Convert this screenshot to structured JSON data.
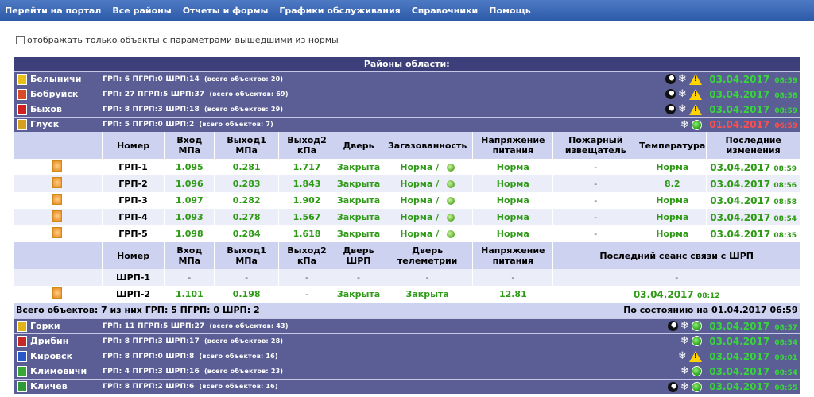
{
  "nav": [
    "Перейти на портал",
    "Все районы",
    "Отчеты и формы",
    "Графики обслуживания",
    "Справочники",
    "Помощь"
  ],
  "filter_label": "отображать только объекты с параметрами вышедшими из нормы",
  "table_title": "Районы области:",
  "regions_top": [
    {
      "name": "Белыничи",
      "grp": "ГРП: 6",
      "pgrp": "ПГРП:0",
      "shrp": "ШРП:14",
      "total": "(всего объектов: 20)",
      "date": "03.04.2017",
      "time": "08:59",
      "status": "ok",
      "icons": [
        "moon-icon",
        "snowflake-icon",
        "warning-icon"
      ],
      "coat": "#e8c01a"
    },
    {
      "name": "Бобруйск",
      "grp": "ГРП: 27",
      "pgrp": "ПГРП:5",
      "shrp": "ШРП:37",
      "total": "(всего объектов: 69)",
      "date": "03.04.2017",
      "time": "08:58",
      "status": "ok",
      "icons": [
        "moon-icon",
        "snowflake-icon",
        "warning-icon"
      ],
      "coat": "#d84a2a"
    },
    {
      "name": "Быхов",
      "grp": "ГРП: 8",
      "pgrp": "ПГРП:3",
      "shrp": "ШРП:18",
      "total": "(всего объектов: 29)",
      "date": "03.04.2017",
      "time": "08:59",
      "status": "ok",
      "icons": [
        "moon-icon",
        "snowflake-icon",
        "warning-icon"
      ],
      "coat": "#cc2222"
    },
    {
      "name": "Глуск",
      "grp": "ГРП: 5",
      "pgrp": "ПГРП:0",
      "shrp": "ШРП:2",
      "total": "(всего объектов: 7)",
      "date": "01.04.2017",
      "time": "06:59",
      "status": "bad",
      "icons": [
        "snowflake-icon",
        "ok-icon"
      ],
      "coat": "#d8a020"
    }
  ],
  "grp_headers": [
    "Номер",
    "Вход МПа",
    "Выход1 МПа",
    "Выход2 кПа",
    "Дверь",
    "Загазованность",
    "Напряжение питания",
    "Пожарный извещатель",
    "Температура",
    "Последние изменения"
  ],
  "grp_rows": [
    {
      "num": "ГРП-1",
      "in": "1.095",
      "out1": "0.281",
      "out2": "1.717",
      "door": "Закрыта",
      "gas": "Норма",
      "volt": "Норма",
      "fire": "-",
      "temp": "Норма",
      "date": "03.04.2017",
      "time": "08:59"
    },
    {
      "num": "ГРП-2",
      "in": "1.096",
      "out1": "0.283",
      "out2": "1.843",
      "door": "Закрыта",
      "gas": "Норма",
      "volt": "Норма",
      "fire": "-",
      "temp": "8.2",
      "date": "03.04.2017",
      "time": "08:56"
    },
    {
      "num": "ГРП-3",
      "in": "1.097",
      "out1": "0.282",
      "out2": "1.902",
      "door": "Закрыта",
      "gas": "Норма",
      "volt": "Норма",
      "fire": "-",
      "temp": "Норма",
      "date": "03.04.2017",
      "time": "08:58"
    },
    {
      "num": "ГРП-4",
      "in": "1.093",
      "out1": "0.278",
      "out2": "1.567",
      "door": "Закрыта",
      "gas": "Норма",
      "volt": "Норма",
      "fire": "-",
      "temp": "Норма",
      "date": "03.04.2017",
      "time": "08:54"
    },
    {
      "num": "ГРП-5",
      "in": "1.098",
      "out1": "0.284",
      "out2": "1.618",
      "door": "Закрыта",
      "gas": "Норма",
      "volt": "Норма",
      "fire": "-",
      "temp": "Норма",
      "date": "03.04.2017",
      "time": "08:35"
    }
  ],
  "shrp_headers": [
    "Номер",
    "Вход МПа",
    "Выход1 МПа",
    "Выход2 кПа",
    "Дверь ШРП",
    "Дверь телеметрии",
    "Напряжение питания",
    "Последний сеанс связи с ШРП"
  ],
  "shrp_rows": [
    {
      "num": "ШРП-1",
      "in": "-",
      "out1": "-",
      "out2": "-",
      "door": "-",
      "tdoor": "-",
      "volt": "-",
      "date": "-",
      "time": ""
    },
    {
      "num": "ШРП-2",
      "in": "1.101",
      "out1": "0.198",
      "out2": "-",
      "door": "Закрыта",
      "tdoor": "Закрыта",
      "volt": "12.81",
      "date": "03.04.2017",
      "time": "08:12"
    }
  ],
  "summary": {
    "left": "Всего объектов: 7   из них   ГРП: 5   ПГРП: 0   ШРП: 2",
    "right": "По состоянию на 01.04.2017 06:59"
  },
  "regions_bottom": [
    {
      "name": "Горки",
      "grp": "ГРП: 11",
      "pgrp": "ПГРП:5",
      "shrp": "ШРП:27",
      "total": "(всего объектов: 43)",
      "date": "03.04.2017",
      "time": "08:57",
      "status": "ok",
      "icons": [
        "moon-icon",
        "snowflake-icon",
        "ok-icon"
      ],
      "coat": "#e2b21a"
    },
    {
      "name": "Дрибин",
      "grp": "ГРП: 8",
      "pgrp": "ПГРП:3",
      "shrp": "ШРП:17",
      "total": "(всего объектов: 28)",
      "date": "03.04.2017",
      "time": "08:54",
      "status": "ok",
      "icons": [
        "snowflake-icon",
        "ok-icon"
      ],
      "coat": "#c52828"
    },
    {
      "name": "Кировск",
      "grp": "ГРП: 8",
      "pgrp": "ПГРП:0",
      "shrp": "ШРП:8",
      "total": "(всего объектов: 16)",
      "date": "03.04.2017",
      "time": "09:01",
      "status": "ok",
      "icons": [
        "snowflake-icon",
        "warning-icon"
      ],
      "coat": "#2a58c8"
    },
    {
      "name": "Климовичи",
      "grp": "ГРП: 4",
      "pgrp": "ПГРП:3",
      "shrp": "ШРП:16",
      "total": "(всего объектов: 23)",
      "date": "03.04.2017",
      "time": "08:54",
      "status": "ok",
      "icons": [
        "snowflake-icon",
        "ok-icon"
      ],
      "coat": "#38a838"
    },
    {
      "name": "Кличев",
      "grp": "ГРП: 8",
      "pgrp": "ПГРП:2",
      "shrp": "ШРП:6",
      "total": "(всего объектов: 16)",
      "date": "03.04.2017",
      "time": "08:55",
      "status": "ok",
      "icons": [
        "moon-icon",
        "snowflake-icon",
        "ok-icon"
      ],
      "coat": "#2e9a38"
    }
  ]
}
